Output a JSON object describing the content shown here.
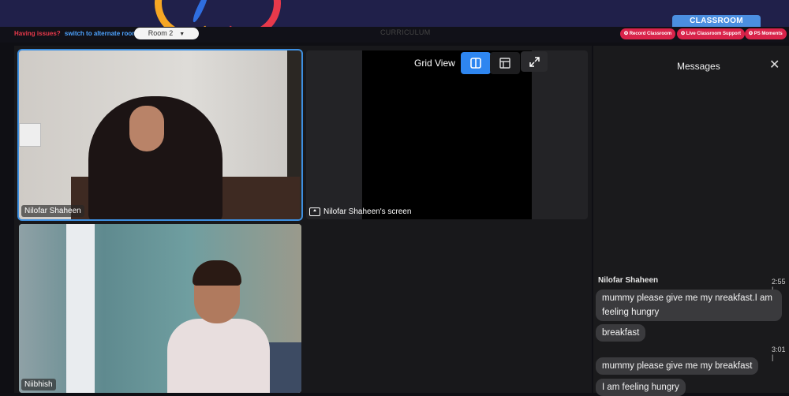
{
  "header": {
    "classroom_tab": "CLASSROOM",
    "curriculum": "CURRICULUM"
  },
  "toolbar": {
    "help_question": "Having issues?",
    "help_action": "switch to alternate room",
    "room": "Room 2",
    "pills": [
      "Record Classroom",
      "Live Classroom Support",
      "PS Moments"
    ]
  },
  "stage": {
    "grid_view_label": "Grid View",
    "tiles": [
      {
        "name": "Nilofar Shaheen"
      },
      {
        "name": "Nilofar Shaheen's screen"
      },
      {
        "name": "Niibhish"
      }
    ]
  },
  "messages": {
    "title": "Messages",
    "sender": "Nilofar Shaheen",
    "time1": "2:55 |",
    "time2": "3:01 |",
    "items": [
      "mummy please give me my nreakfast.I am feeling hungry",
      "breakfast",
      "mummy please give me my breakfast",
      "I am feeling hungry"
    ]
  },
  "colors": {
    "accent": "#2e86f0",
    "alert": "#d9234a",
    "link": "#4da3ff"
  }
}
